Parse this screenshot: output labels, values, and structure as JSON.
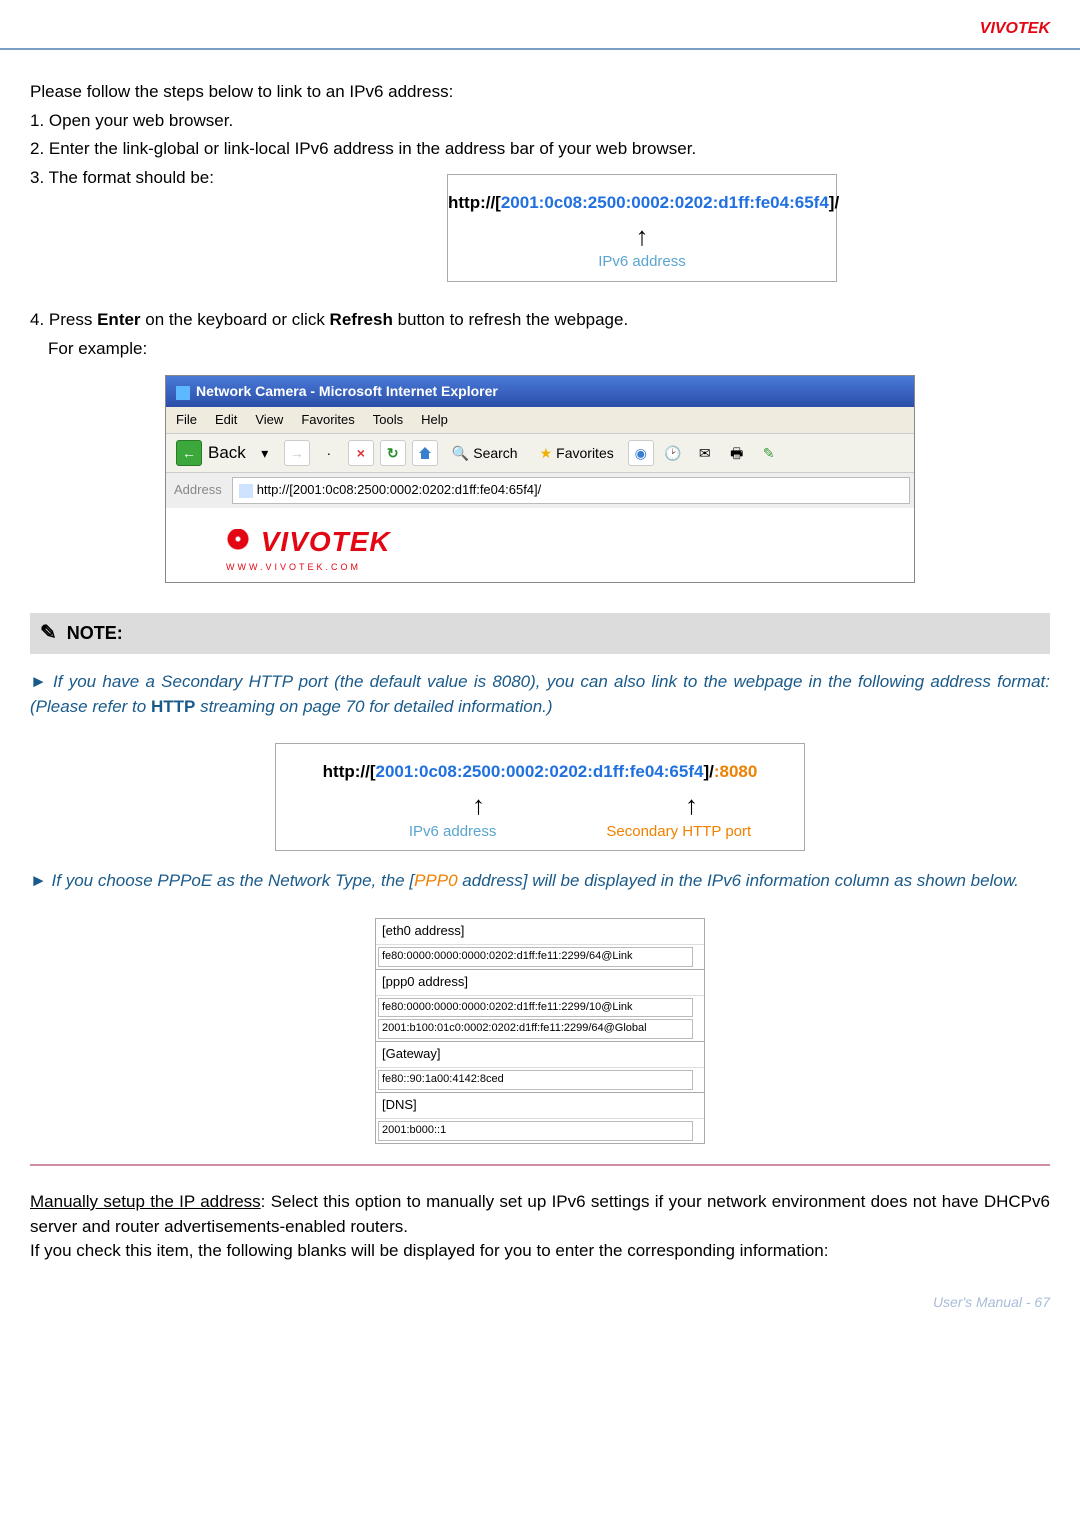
{
  "header": {
    "brand": "VIVOTEK"
  },
  "intro": {
    "lead": "Please follow the steps below to link to an IPv6 address:",
    "step1": "1. Open your web browser.",
    "step2": "2. Enter the link-global or link-local IPv6 address in the address bar of your web browser.",
    "step3": "3. The format should be:"
  },
  "url1": {
    "prefix": "http://[",
    "addr": "2001:0c08:2500:0002:0202:d1ff:fe04:65f4",
    "suffix": "]/",
    "label": "IPv6 address"
  },
  "step4": {
    "a": "4. Press ",
    "b": "Enter",
    "c": " on the keyboard or click ",
    "d": "Refresh",
    "e": " button to refresh the webpage.",
    "f": "For example:"
  },
  "ie": {
    "title": "Network Camera - Microsoft Internet Explorer",
    "menu": [
      "File",
      "Edit",
      "View",
      "Favorites",
      "Tools",
      "Help"
    ],
    "back": "Back",
    "search": "Search",
    "favorites": "Favorites",
    "addr_label": "Address",
    "addr_value": "http://[2001:0c08:2500:0002:0202:d1ff:fe04:65f4]/",
    "logo_text": "VIVOTEK",
    "logo_tag": "WWW.VIVOTEK.COM"
  },
  "note": {
    "title": "NOTE:",
    "p1a": "► If you have a Secondary HTTP port (the default value is 8080), you can also link to the webpage in the following address format: (Please refer to ",
    "p1b": "HTTP",
    "p1c": " streaming on page 70 for detailed information.)",
    "p2a": "► If you choose PPPoE as the Network Type, the [",
    "p2b": "PPP0",
    "p2c": " address] will be displayed in the IPv6 information column as shown below."
  },
  "url2": {
    "prefix": "http://[",
    "addr": "2001:0c08:2500:0002:0202:d1ff:fe04:65f4",
    "suffix": "]/",
    "port": ":8080",
    "label_addr": "IPv6 address",
    "label_port": "Secondary HTTP port"
  },
  "infotable": {
    "eth0": "[eth0 address]",
    "eth0v": "fe80:0000:0000:0000:0202:d1ff:fe11:2299/64@Link",
    "ppp0": "[ppp0 address]",
    "ppp0v1": "fe80:0000:0000:0000:0202:d1ff:fe11:2299/10@Link",
    "ppp0v2": "2001:b100:01c0:0002:0202:d1ff:fe11:2299/64@Global",
    "gw": "[Gateway]",
    "gwv": "fe80::90:1a00:4142:8ced",
    "dns": "[DNS]",
    "dnsv": "2001:b000::1"
  },
  "manual": {
    "u": "Manually setup the IP address",
    "a": ": Select this option to manually set up IPv6 settings if your network environment does not have DHCPv6 server and router advertisements-enabled routers.",
    "b": "If you check this item, the following blanks will be displayed for you to enter the corresponding information:"
  },
  "footer": {
    "text": "User's Manual - 67"
  }
}
